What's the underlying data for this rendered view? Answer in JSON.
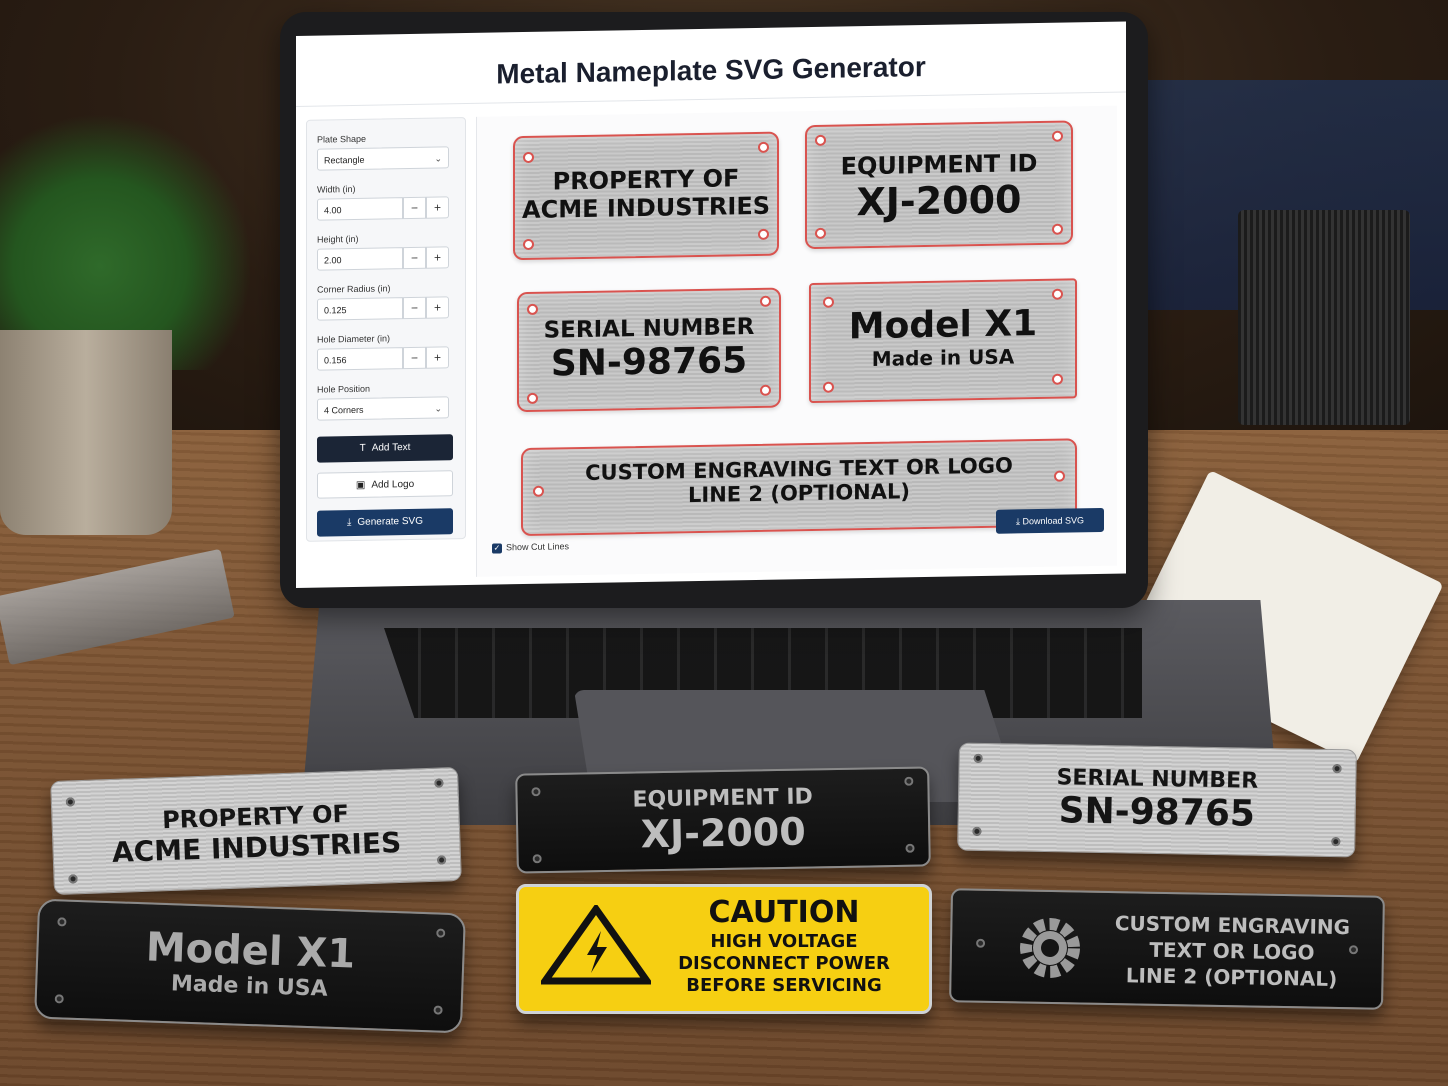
{
  "app": {
    "title": "Metal Nameplate SVG Generator"
  },
  "sidebar": {
    "plate_shape_label": "Plate Shape",
    "plate_shape_value": "Rectangle",
    "width_label": "Width (in)",
    "width_value": "4.00",
    "height_label": "Height (in)",
    "height_value": "2.00",
    "corner_radius_label": "Corner Radius (in)",
    "corner_radius_value": "0.125",
    "hole_diameter_label": "Hole Diameter (in)",
    "hole_diameter_value": "0.156",
    "hole_position_label": "Hole Position",
    "hole_position_value": "4 Corners",
    "minus": "−",
    "plus": "+",
    "add_text_label": "Add Text",
    "add_logo_label": "Add Logo",
    "generate_label": "Generate SVG"
  },
  "preview": {
    "plates": [
      {
        "line1": "PROPERTY OF",
        "line2": "ACME INDUSTRIES"
      },
      {
        "line1": "EQUIPMENT ID",
        "line2": "XJ-2000"
      },
      {
        "line1": "SERIAL NUMBER",
        "line2": "SN-98765"
      },
      {
        "line1": "Model X1",
        "line2": "Made in USA"
      },
      {
        "line1": "CUSTOM ENGRAVING TEXT OR LOGO",
        "line2": "LINE 2 (OPTIONAL)"
      }
    ],
    "show_cut_lines_label": "Show Cut Lines",
    "show_cut_lines_checked": true,
    "download_label": "Download SVG"
  },
  "desk_plates": {
    "acme": {
      "line1": "PROPERTY OF",
      "line2": "ACME INDUSTRIES"
    },
    "equipment": {
      "line1": "EQUIPMENT ID",
      "line2": "XJ-2000"
    },
    "serial": {
      "line1": "SERIAL NUMBER",
      "line2": "SN-98765"
    },
    "model": {
      "line1": "Model X1",
      "line2": "Made in USA"
    },
    "caution": {
      "line1": "CAUTION",
      "line2": "HIGH VOLTAGE",
      "line3": "DISCONNECT POWER",
      "line4": "BEFORE SERVICING"
    },
    "custom": {
      "line1": "CUSTOM ENGRAVING",
      "line2": "TEXT OR LOGO",
      "line3": "LINE 2 (OPTIONAL)"
    }
  },
  "colors": {
    "primary": "#1a3a66",
    "dark_button": "#1b2536",
    "cut_line": "#d9534f",
    "caution_yellow": "#f6cf12"
  }
}
